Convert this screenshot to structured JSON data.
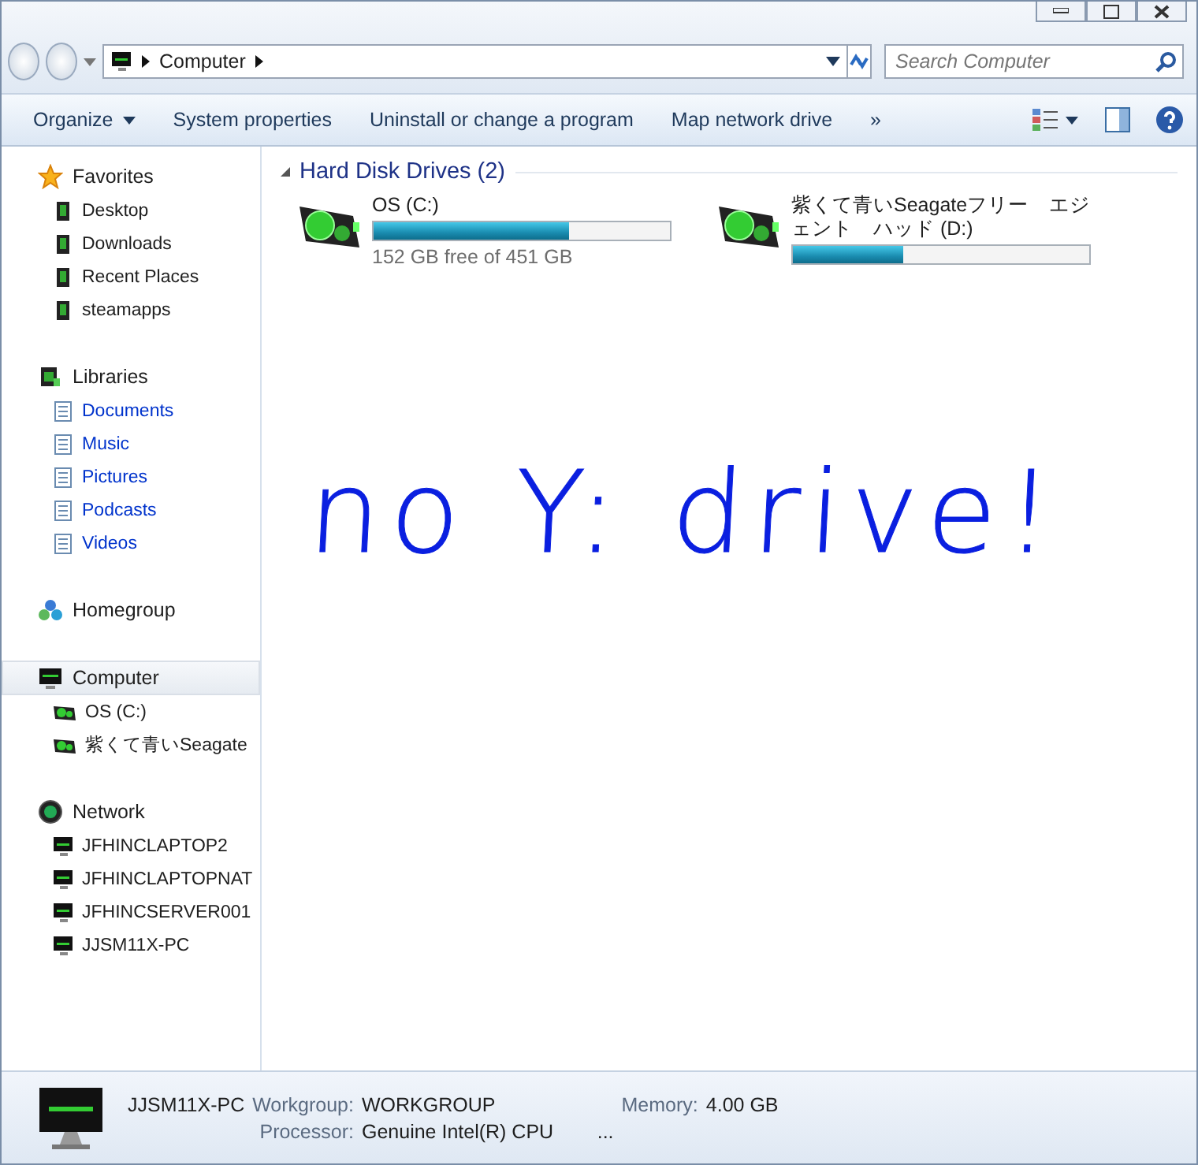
{
  "address": {
    "crumbs": [
      "Computer"
    ]
  },
  "search": {
    "placeholder": "Search Computer"
  },
  "toolbar": {
    "buttons": [
      {
        "label": "Organize",
        "kind": "menu"
      },
      {
        "label": "System properties",
        "kind": "plain"
      },
      {
        "label": "Uninstall or change a program",
        "kind": "plain"
      },
      {
        "label": "Map network drive",
        "kind": "plain"
      },
      {
        "label": "»",
        "kind": "plain"
      }
    ]
  },
  "sidebar": {
    "groups": [
      {
        "label": "Favorites",
        "selected": false,
        "children": [
          {
            "label": "Desktop",
            "link": false
          },
          {
            "label": "Downloads",
            "link": false
          },
          {
            "label": "Recent Places",
            "link": false
          },
          {
            "label": "steamapps",
            "link": false
          }
        ]
      },
      {
        "label": "Libraries",
        "selected": false,
        "children": [
          {
            "label": "Documents",
            "link": true
          },
          {
            "label": "Music",
            "link": true
          },
          {
            "label": "Pictures",
            "link": true
          },
          {
            "label": "Podcasts",
            "link": true
          },
          {
            "label": "Videos",
            "link": true
          }
        ]
      },
      {
        "label": "Homegroup",
        "selected": false
      },
      {
        "label": "Computer",
        "selected": true,
        "children": [
          {
            "label": "OS (C:)",
            "link": false
          },
          {
            "label": "紫くて青いSeagate",
            "link": false
          }
        ]
      },
      {
        "label": "Network",
        "selected": false,
        "children": [
          {
            "label": "JFHINCLAPTOP2",
            "link": false
          },
          {
            "label": "JFHINCLAPTOPNAT",
            "link": false
          },
          {
            "label": "JFHINCSERVER001",
            "link": false
          },
          {
            "label": "JJSM11X-PC",
            "link": false
          }
        ]
      }
    ]
  },
  "section": {
    "title": "Hard Disk Drives (2)",
    "drives": [
      {
        "name": "OS (C:)",
        "level": 0.66,
        "free": "152 GB free of 451 GB"
      },
      {
        "name": "紫くて青いSeagateフリー　エジェント　ハッド (D:)",
        "level": 0.37
      }
    ]
  },
  "annotation": "no Y: drive!",
  "details": {
    "name": "JJSM11X-PC",
    "fields": [
      {
        "label": "Workgroup:",
        "value": "WORKGROUP"
      },
      {
        "label": "Memory:",
        "value": "4.00 GB"
      },
      {
        "label": "Processor:",
        "value": "Genuine Intel(R) CPU        ..."
      }
    ]
  }
}
